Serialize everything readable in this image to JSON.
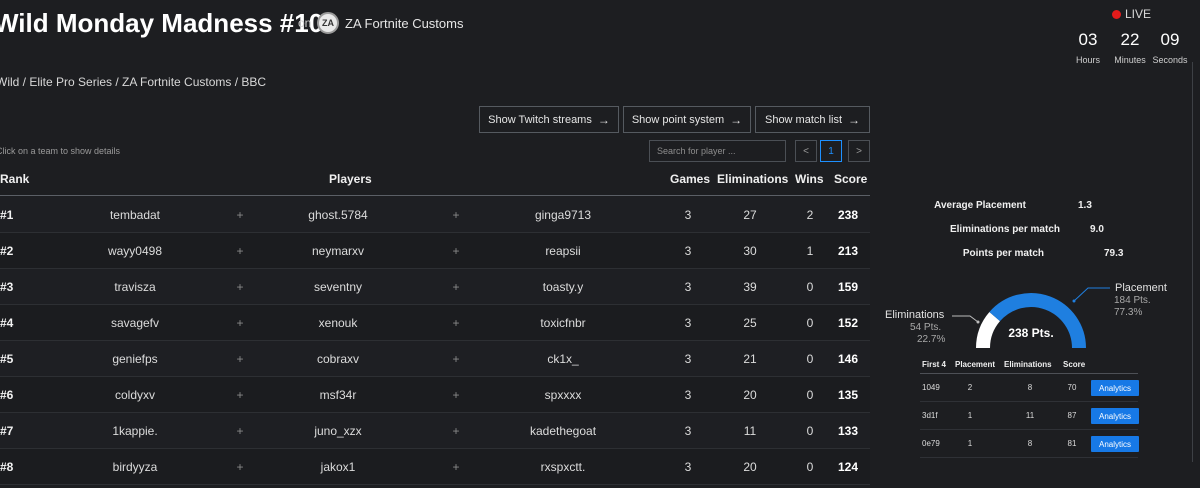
{
  "header": {
    "title": "Wild Monday Madness #10",
    "on_text": "on",
    "org_logo_text": "ZA",
    "org_name": "ZA Fortnite Customs",
    "live_label": "LIVE",
    "countdown": [
      {
        "value": "03",
        "label": "Hours"
      },
      {
        "value": "22",
        "label": "Minutes"
      },
      {
        "value": "09",
        "label": "Seconds"
      }
    ]
  },
  "breadcrumb": "Wild / Elite Pro Series / ZA Fortnite Customs / BBC",
  "actions": {
    "twitch": "Show Twitch streams",
    "points": "Show point system",
    "matches": "Show match list"
  },
  "controls": {
    "hint": "Click on a team to show details",
    "search_placeholder": "Search for player ...",
    "page_prev": "<",
    "page_current": "1",
    "page_next": ">"
  },
  "table": {
    "headers": {
      "rank": "Rank",
      "players": "Players",
      "games": "Games",
      "eliminations": "Eliminations",
      "wins": "Wins",
      "score": "Score"
    },
    "plus": "+",
    "rows": [
      {
        "rank": "#1",
        "p1": "tembadat",
        "p2": "ghost.5784",
        "p3": "ginga9713",
        "games": "3",
        "elims": "27",
        "wins": "2",
        "score": "238"
      },
      {
        "rank": "#2",
        "p1": "wayy0498",
        "p2": "neymarxv",
        "p3": "reapsii",
        "games": "3",
        "elims": "30",
        "wins": "1",
        "score": "213"
      },
      {
        "rank": "#3",
        "p1": "travisza",
        "p2": "seventny",
        "p3": "toasty.y",
        "games": "3",
        "elims": "39",
        "wins": "0",
        "score": "159"
      },
      {
        "rank": "#4",
        "p1": "savagefv",
        "p2": "xenouk",
        "p3": "toxicfnbr",
        "games": "3",
        "elims": "25",
        "wins": "0",
        "score": "152"
      },
      {
        "rank": "#5",
        "p1": "geniefps",
        "p2": "cobraxv",
        "p3": "ck1x_",
        "games": "3",
        "elims": "21",
        "wins": "0",
        "score": "146"
      },
      {
        "rank": "#6",
        "p1": "coldyxv",
        "p2": "msf34r",
        "p3": "spxxxx",
        "games": "3",
        "elims": "20",
        "wins": "0",
        "score": "135"
      },
      {
        "rank": "#7",
        "p1": "1kappie.",
        "p2": "juno_xzx",
        "p3": "kadethegoat",
        "games": "3",
        "elims": "11",
        "wins": "0",
        "score": "133"
      },
      {
        "rank": "#8",
        "p1": "birdyyza",
        "p2": "jakox1",
        "p3": "rxspxctt.",
        "games": "3",
        "elims": "20",
        "wins": "0",
        "score": "124"
      }
    ]
  },
  "details": {
    "stats": [
      {
        "label": "Average Placement",
        "value": "1.3"
      },
      {
        "label": "Eliminations per match",
        "value": "9.0"
      },
      {
        "label": "Points per match",
        "value": "79.3"
      }
    ],
    "gauge": {
      "total": "238 Pts.",
      "placement": {
        "label": "Placement",
        "pts": "184 Pts.",
        "pct": "77.3%",
        "fraction": 0.773,
        "color": "#1f7fe0"
      },
      "eliminations": {
        "label": "Eliminations",
        "pts": "54 Pts.",
        "pct": "22.7%",
        "fraction": 0.227,
        "color": "#ffffff"
      }
    },
    "matches": {
      "headers": {
        "id": "First 4",
        "placement": "Placement",
        "elims": "Eliminations",
        "score": "Score"
      },
      "button_label": "Analytics",
      "rows": [
        {
          "id": "1049",
          "placement": "2",
          "elims": "8",
          "score": "70"
        },
        {
          "id": "3d1f",
          "placement": "1",
          "elims": "11",
          "score": "87"
        },
        {
          "id": "0e79",
          "placement": "1",
          "elims": "8",
          "score": "81"
        }
      ]
    }
  }
}
